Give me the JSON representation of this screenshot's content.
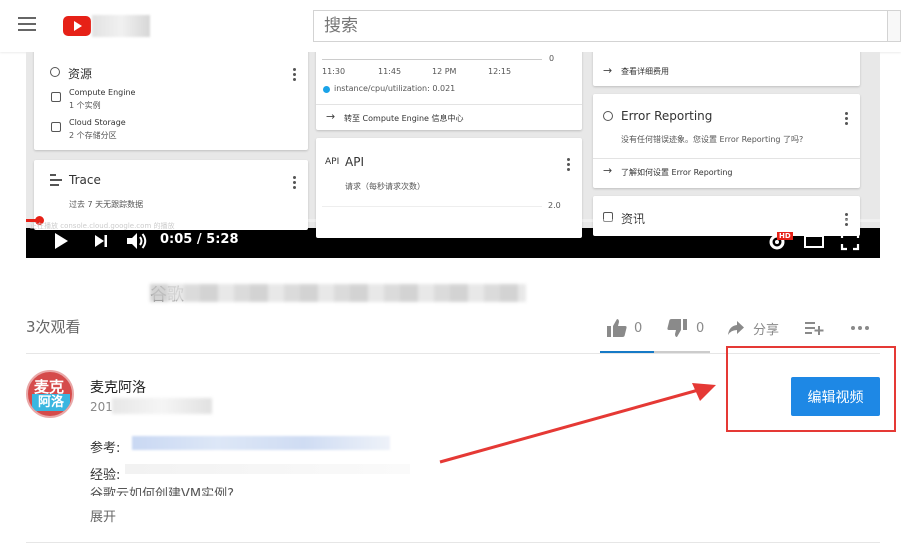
{
  "header": {
    "search_placeholder": "搜索"
  },
  "video": {
    "time_current": "0:05",
    "time_total": "5:28",
    "time_sep": " / ",
    "progress_fraction": 0.0153,
    "hover_source": "正在播放 console.cloud.google.com 的播放",
    "hd_badge": "HD",
    "frame": {
      "resources": {
        "title": "资源",
        "items": [
          {
            "name": "Compute Engine",
            "sub": "1 个实例"
          },
          {
            "name": "Cloud Storage",
            "sub": "2 个存储分区"
          }
        ]
      },
      "trace": {
        "title": "Trace",
        "sub": "过去 7 天无跟踪数据"
      },
      "cpu_chart": {
        "x_ticks": [
          "11:30",
          "11:45",
          "12 PM",
          "12:15"
        ],
        "y_zero": "0",
        "legend": "instance/cpu/utilization: 0.021",
        "link": "转至 Compute Engine 信息中心"
      },
      "api": {
        "title": "API",
        "icon_text": "API",
        "sub": "请求（每秒请求次数）",
        "y_tick": "2.0"
      },
      "billing": {
        "link": "查看详细费用"
      },
      "error_reporting": {
        "title": "Error Reporting",
        "sub": "没有任何错误迹象。您设置 Error Reporting 了吗?",
        "link": "了解如何设置 Error Reporting"
      },
      "news": {
        "title": "资讯"
      }
    }
  },
  "title": {
    "visible": "谷歌"
  },
  "stats": {
    "views": "3次观看",
    "likes": "0",
    "dislikes": "0",
    "share": "分享"
  },
  "channel": {
    "name": "麦克阿洛",
    "avatar_line1": "麦克",
    "avatar_line2": "阿洛",
    "date_prefix": "201"
  },
  "actions": {
    "edit_video": "编辑视频"
  },
  "description": {
    "ref_label": "参考:",
    "exp_label": "经验:",
    "line3": "谷歌云如何创建VM实例?",
    "expand": "展开"
  },
  "colors": {
    "brand_red": "#e62117",
    "accent_blue": "#1e88e5",
    "annotation_red": "#e53935"
  }
}
